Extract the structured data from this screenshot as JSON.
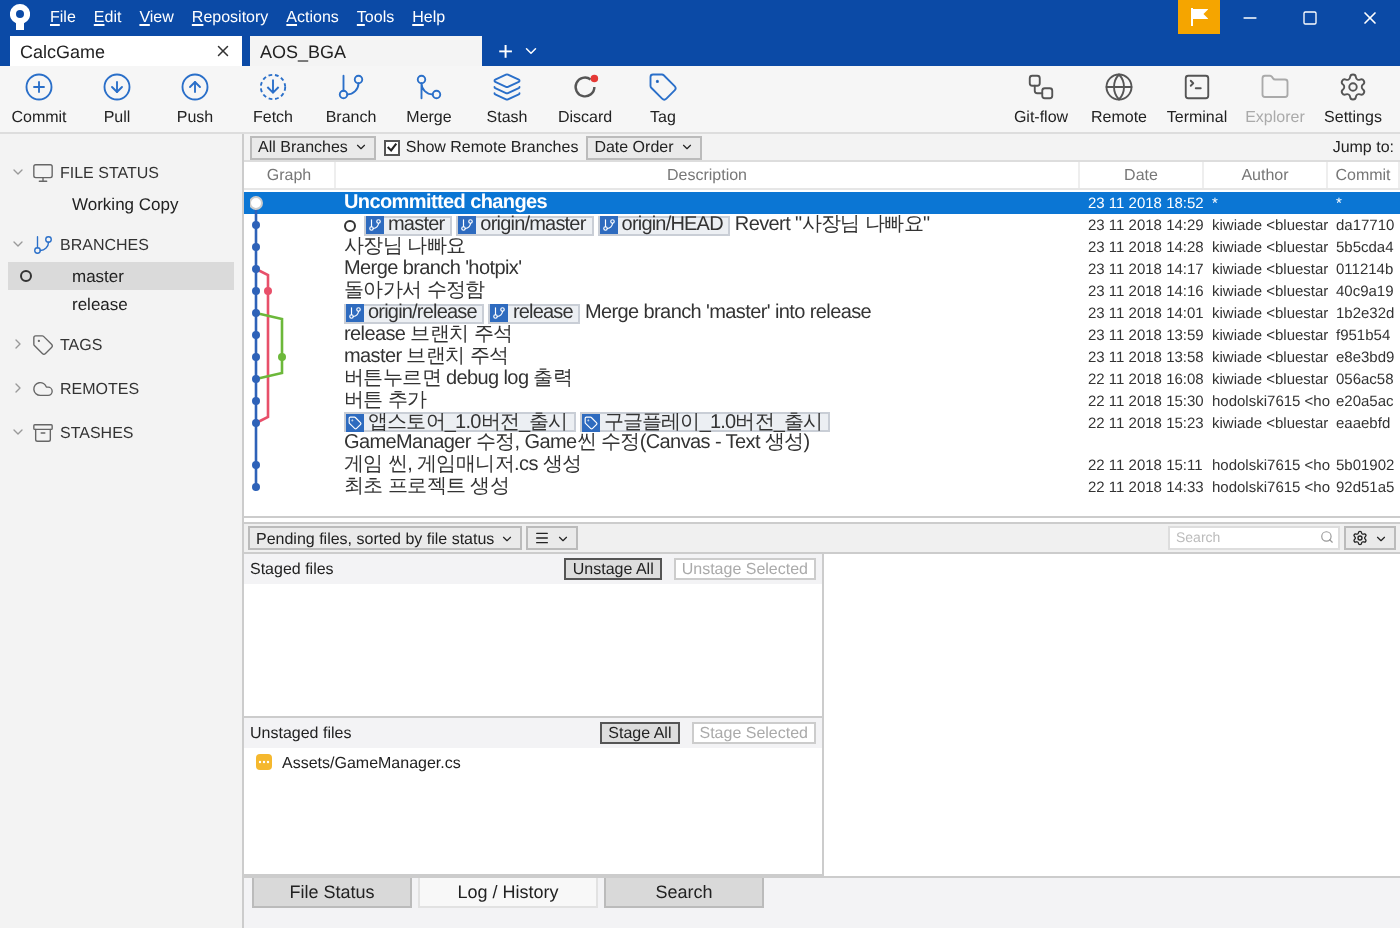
{
  "window": {
    "menu": [
      "File",
      "Edit",
      "View",
      "Repository",
      "Actions",
      "Tools",
      "Help"
    ]
  },
  "repo_tabs": [
    {
      "label": "CalcGame",
      "selected": true
    },
    {
      "label": "AOS_BGA",
      "selected": false
    }
  ],
  "new_tab": "+",
  "toolbar": {
    "left": [
      {
        "label": "Commit",
        "kind": "commit",
        "disabled": false
      },
      {
        "label": "Pull",
        "kind": "pull",
        "disabled": false
      },
      {
        "label": "Push",
        "kind": "push",
        "disabled": false
      },
      {
        "label": "Fetch",
        "kind": "fetch",
        "disabled": false
      },
      {
        "label": "Branch",
        "kind": "branch",
        "disabled": false
      },
      {
        "label": "Merge",
        "kind": "merge",
        "disabled": false
      },
      {
        "label": "Stash",
        "kind": "stash",
        "disabled": false
      },
      {
        "label": "Discard",
        "kind": "discard",
        "disabled": false
      },
      {
        "label": "Tag",
        "kind": "tag",
        "disabled": false
      }
    ],
    "right": [
      {
        "label": "Git-flow",
        "kind": "gitflow",
        "disabled": false
      },
      {
        "label": "Remote",
        "kind": "remote",
        "disabled": false
      },
      {
        "label": "Terminal",
        "kind": "terminal",
        "disabled": false
      },
      {
        "label": "Explorer",
        "kind": "explorer",
        "disabled": true
      },
      {
        "label": "Settings",
        "kind": "settings",
        "disabled": false
      }
    ]
  },
  "sidebar": [
    {
      "label": "FILE STATUS",
      "kind": "file-status",
      "expanded": true,
      "items": [
        {
          "label": "Working Copy",
          "selected": false,
          "current": false
        }
      ]
    },
    {
      "label": "BRANCHES",
      "kind": "branches",
      "expanded": true,
      "items": [
        {
          "label": "master",
          "selected": true,
          "current": true
        },
        {
          "label": "release",
          "selected": false,
          "current": false
        }
      ]
    },
    {
      "label": "TAGS",
      "kind": "tags",
      "expanded": false
    },
    {
      "label": "REMOTES",
      "kind": "remotes",
      "expanded": false
    },
    {
      "label": "STASHES",
      "kind": "stashes",
      "expanded": true
    }
  ],
  "history": {
    "branches_filter": "All Branches",
    "show_remote": {
      "label": "Show Remote Branches",
      "checked": true
    },
    "order": "Date Order",
    "jump_to": "Jump to:",
    "columns": [
      "Graph",
      "Description",
      "Date",
      "Author",
      "Commit"
    ],
    "rows": [
      {
        "kind": "uncommitted",
        "selected": true,
        "head": false,
        "description": "Uncommitted changes",
        "date": "23 11 2018 18:52",
        "author": "*",
        "commit": "*"
      },
      {
        "kind": "commit",
        "selected": false,
        "head": true,
        "refs": [
          {
            "kind": "branch",
            "label": "master"
          },
          {
            "kind": "branch",
            "label": "origin/master"
          },
          {
            "kind": "branch",
            "label": "origin/HEAD"
          }
        ],
        "description": "Revert \"사장님 나빠요\"",
        "date": "23 11 2018 14:29",
        "author": "kiwiade <bluestar",
        "commit": "da17710"
      },
      {
        "kind": "commit",
        "selected": false,
        "head": false,
        "description": "사장님 나빠요",
        "date": "23 11 2018 14:28",
        "author": "kiwiade <bluestar",
        "commit": "5b5cda4"
      },
      {
        "kind": "commit",
        "selected": false,
        "head": false,
        "description": "Merge branch 'hotpix'",
        "date": "23 11 2018 14:17",
        "author": "kiwiade <bluestar",
        "commit": "011214b"
      },
      {
        "kind": "commit",
        "selected": false,
        "head": false,
        "description": "돌아가서 수정함",
        "date": "23 11 2018 14:16",
        "author": "kiwiade <bluestar",
        "commit": "40c9a19"
      },
      {
        "kind": "commit",
        "selected": false,
        "head": false,
        "refs": [
          {
            "kind": "branch",
            "label": "origin/release"
          },
          {
            "kind": "branch",
            "label": "release"
          }
        ],
        "description": "Merge branch 'master' into release",
        "date": "23 11 2018 14:01",
        "author": "kiwiade <bluestar",
        "commit": "1b2e32d"
      },
      {
        "kind": "commit",
        "selected": false,
        "head": false,
        "description": "release 브랜치 주석",
        "date": "23 11 2018 13:59",
        "author": "kiwiade <bluestar",
        "commit": "f951b54"
      },
      {
        "kind": "commit",
        "selected": false,
        "head": false,
        "description": "master 브랜치 주석",
        "date": "23 11 2018 13:58",
        "author": "kiwiade <bluestar",
        "commit": "e8e3bd9"
      },
      {
        "kind": "commit",
        "selected": false,
        "head": false,
        "description": "버튼누르면 debug log 출력",
        "date": "22 11 2018 16:08",
        "author": "kiwiade <bluestar",
        "commit": "056ac58"
      },
      {
        "kind": "commit",
        "selected": false,
        "head": false,
        "description": "버튼 추가",
        "date": "22 11 2018 15:30",
        "author": "hodolski7615 <ho",
        "commit": "e20a5ac"
      },
      {
        "kind": "commit",
        "selected": false,
        "head": false,
        "refs": [
          {
            "kind": "tag",
            "label": "앱스토어_1.0버전_출시"
          },
          {
            "kind": "tag",
            "label": "구글플레이_1.0버전_출시"
          }
        ],
        "description": "GameManager 수정, Game씬 수정(Canvas - Text 생성)",
        "date": "22 11 2018 15:23",
        "author": "kiwiade <bluestar",
        "commit": "eaaebfd"
      },
      {
        "kind": "commit",
        "selected": false,
        "head": false,
        "description": "게임 씬, 게임매니저.cs 생성",
        "date": "22 11 2018 15:11",
        "author": "hodolski7615 <ho",
        "commit": "5b01902"
      },
      {
        "kind": "commit",
        "selected": false,
        "head": false,
        "description": "최초 프로젝트 생성",
        "date": "22 11 2018 14:33",
        "author": "hodolski7615 <ho",
        "commit": "92d51a5"
      }
    ]
  },
  "pending": {
    "sort_filter": "Pending files, sorted by file status",
    "search": {
      "placeholder": "Search"
    },
    "staged": {
      "title": "Staged files",
      "buttons": [
        {
          "label": "Unstage All",
          "disabled": false
        },
        {
          "label": "Unstage Selected",
          "disabled": true
        }
      ]
    },
    "unstaged": {
      "title": "Unstaged files",
      "buttons": [
        {
          "label": "Stage All",
          "disabled": false
        },
        {
          "label": "Stage Selected",
          "disabled": true
        }
      ],
      "files": [
        {
          "path": "Assets/GameManager.cs",
          "kind": "modified"
        }
      ]
    }
  },
  "bottom_tabs": [
    {
      "label": "File Status",
      "selected": false
    },
    {
      "label": "Log / History",
      "selected": true
    },
    {
      "label": "Search",
      "selected": false
    }
  ]
}
